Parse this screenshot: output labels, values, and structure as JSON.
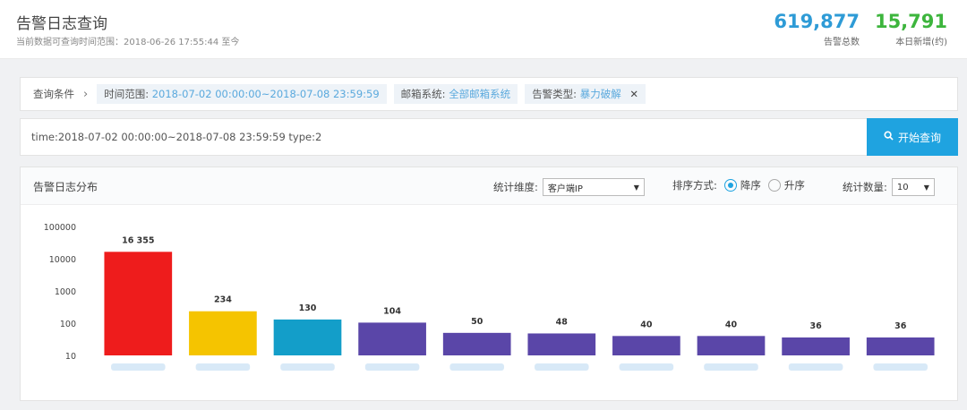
{
  "header": {
    "title": "告警日志查询",
    "subtitle": "当前数据可查询时间范围：2018-06-26 17:55:44 至今",
    "total_value": "619,877",
    "total_label": "告警总数",
    "today_value": "15,791",
    "today_label": "本日新增(约)"
  },
  "filters": {
    "crumb_label": "查询条件",
    "time_key": "时间范围:",
    "time_value": "2018-07-02 00:00:00~2018-07-08 23:59:59",
    "mail_key": "邮箱系统:",
    "mail_value": "全部邮箱系统",
    "type_key": "告警类型:",
    "type_value": "暴力破解"
  },
  "query": {
    "value": "time:2018-07-02 00:00:00~2018-07-08 23:59:59 type:2",
    "button_label": "开始查询"
  },
  "panel": {
    "title": "告警日志分布",
    "dimension_label": "统计维度:",
    "dimension_value": "客户端IP",
    "sort_label": "排序方式:",
    "sort_desc": "降序",
    "sort_asc": "升序",
    "sort_selected": "desc",
    "count_label": "统计数量:",
    "count_value": "10"
  },
  "chart_data": {
    "type": "bar",
    "yscale": "log",
    "ylim": [
      10,
      100000
    ],
    "yticks": [
      "100000",
      "10000",
      "1000",
      "100",
      "10"
    ],
    "values": [
      16355,
      234,
      130,
      104,
      50,
      48,
      40,
      40,
      36,
      36
    ],
    "value_labels": [
      "16 355",
      "234",
      "130",
      "104",
      "50",
      "48",
      "40",
      "40",
      "36",
      "36"
    ],
    "colors": [
      "#ee1c1c",
      "#f5c400",
      "#139ec9",
      "#5a46a8",
      "#5a46a8",
      "#5a46a8",
      "#5a46a8",
      "#5a46a8",
      "#5a46a8",
      "#5a46a8"
    ]
  }
}
